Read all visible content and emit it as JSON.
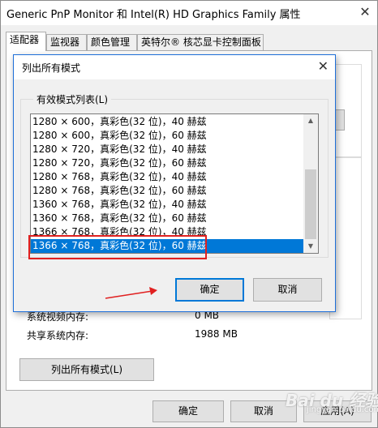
{
  "window": {
    "title": "Generic PnP Monitor 和 Intel(R) HD Graphics Family 属性",
    "close_glyph": "✕"
  },
  "tabs": [
    {
      "label": "适配器",
      "active": true
    },
    {
      "label": "监视器",
      "active": false
    },
    {
      "label": "颜色管理",
      "active": false
    },
    {
      "label": "英特尔® 核芯显卡控制面板",
      "active": false
    }
  ],
  "adapter_panel": {
    "memory_rows": [
      {
        "label": "系统视频内存:",
        "value": "0 MB"
      },
      {
        "label": "共享系统内存:",
        "value": "1988 MB"
      }
    ],
    "list_all_modes_button": "列出所有模式(L)"
  },
  "bottom_buttons": {
    "ok": "确定",
    "cancel": "取消",
    "apply": "应用(A)"
  },
  "dialog": {
    "title": "列出所有模式",
    "close_glyph": "✕",
    "group_label": "有效模式列表(L)",
    "modes": [
      "1280 × 600，真彩色(32 位)，40 赫兹",
      "1280 × 600，真彩色(32 位)，60 赫兹",
      "1280 × 720，真彩色(32 位)，40 赫兹",
      "1280 × 720，真彩色(32 位)，60 赫兹",
      "1280 × 768，真彩色(32 位)，40 赫兹",
      "1280 × 768，真彩色(32 位)，60 赫兹",
      "1360 × 768，真彩色(32 位)，40 赫兹",
      "1360 × 768，真彩色(32 位)，60 赫兹",
      "1366 × 768，真彩色(32 位)，40 赫兹",
      "1366 × 768，真彩色(32 位)，60 赫兹"
    ],
    "selected_index": 9,
    "scroll_up_glyph": "▲",
    "scroll_down_glyph": "▼",
    "ok_button": "确定",
    "cancel_button": "取消"
  },
  "annotations": {
    "highlight_color": "#e02020",
    "arrow_icon": "red-arrow"
  },
  "watermark": {
    "brand": "Bai du 经验",
    "url": "jingyan.baidu.com"
  }
}
